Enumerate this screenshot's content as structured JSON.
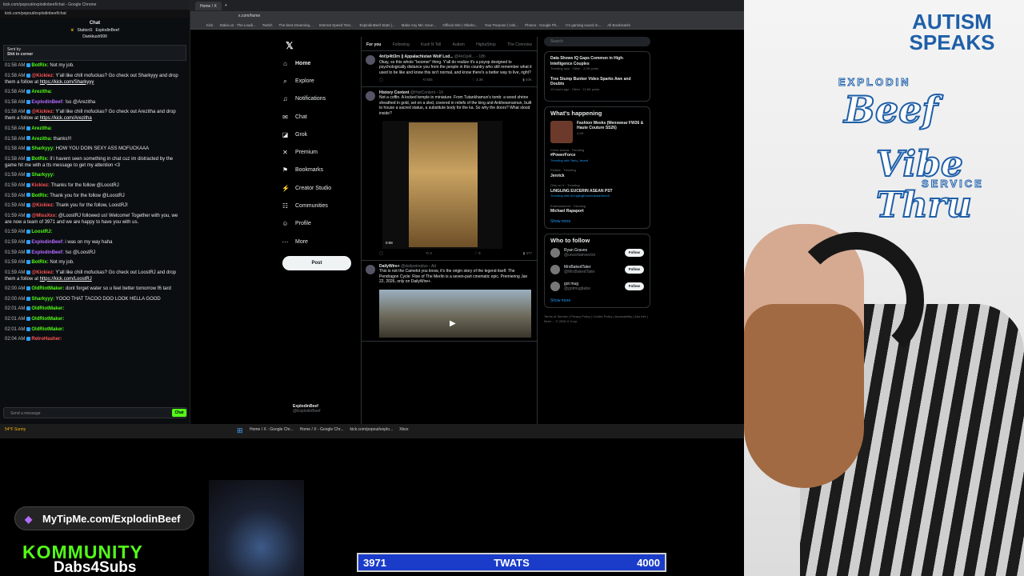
{
  "chat": {
    "window_title": "kick.com/popout/explodinbeef/chat - Google Chrome",
    "url": "kick.com/popout/explodinbeef/chat",
    "header": "Chat",
    "leaders": [
      "StationS",
      "ExplodinBeef",
      "Dankkush999"
    ],
    "pinned_by": "Sent by",
    "pinned_text": "Shit in corner",
    "messages": [
      {
        "time": "01:58 AM",
        "user": "BotRix:",
        "color": "#53fc18",
        "text": "Not my job.",
        "link": ""
      },
      {
        "time": "01:58 AM",
        "user": "@Kickiez:",
        "color": "#f55",
        "text": "Y'all like chill mofuckas? Go check out Sharkyyy and drop them a follow at",
        "link": "https://kick.com/Sharkyyy"
      },
      {
        "time": "01:58 AM",
        "user": "Arezitha:",
        "color": "#53fc18",
        "text": "",
        "link": ""
      },
      {
        "time": "01:58 AM",
        "user": "ExplodinBeef:",
        "color": "#b36bff",
        "text": "!so @Arezitha",
        "link": ""
      },
      {
        "time": "01:58 AM",
        "user": "@Kickiez:",
        "color": "#f55",
        "text": "Y'all like chill mofuckas? Go check out Arezitha and drop them a follow at",
        "link": "https://kick.com/Arezitha"
      },
      {
        "time": "01:58 AM",
        "user": "Arezitha:",
        "color": "#53fc18",
        "text": "",
        "link": ""
      },
      {
        "time": "01:58 AM",
        "user": "Arezitha:",
        "color": "#53fc18",
        "text": "thanks!!!",
        "link": ""
      },
      {
        "time": "01:58 AM",
        "user": "Sharkyyy:",
        "color": "#53fc18",
        "text": "HOW YOU DOIN SEXY ASS MOFUCKAAA",
        "link": ""
      },
      {
        "time": "01:58 AM",
        "user": "BotRix:",
        "color": "#53fc18",
        "text": "if i havent seen something in chat cuz im distracted by the game hit me with a tts message to get my attention <3",
        "link": ""
      },
      {
        "time": "01:59 AM",
        "user": "Sharkyyy:",
        "color": "#53fc18",
        "text": "",
        "link": ""
      },
      {
        "time": "01:59 AM",
        "user": "Kickiez:",
        "color": "#f55",
        "text": "Thanks for the follow @LoostRJ",
        "link": ""
      },
      {
        "time": "01:59 AM",
        "user": "BotRix:",
        "color": "#53fc18",
        "text": "Thank you for the follow @LoostRJ",
        "link": ""
      },
      {
        "time": "01:59 AM",
        "user": "@Kickiez:",
        "color": "#f55",
        "text": "Thank you for the follow, LoostRJ!",
        "link": ""
      },
      {
        "time": "01:59 AM",
        "user": "@MissXxx:",
        "color": "#f55",
        "text": "@LoostRJ followed us! Welcome! Together with you, we are now a team of 3971 and we are happy to have you with us.",
        "link": ""
      },
      {
        "time": "01:59 AM",
        "user": "LoostRJ:",
        "color": "#53fc18",
        "text": "",
        "link": ""
      },
      {
        "time": "01:59 AM",
        "user": "ExplodinBeef:",
        "color": "#b36bff",
        "text": "i was on my way haha",
        "link": ""
      },
      {
        "time": "01:59 AM",
        "user": "ExplodinBeef:",
        "color": "#b36bff",
        "text": "!so @LoostRJ",
        "link": ""
      },
      {
        "time": "01:59 AM",
        "user": "BotRix:",
        "color": "#53fc18",
        "text": "Not my job.",
        "link": ""
      },
      {
        "time": "01:59 AM",
        "user": "@Kickiez:",
        "color": "#f55",
        "text": "Y'all like chill mofuckas? Go check out LoostRJ and drop them a follow at",
        "link": "https://kick.com/LoostRJ"
      },
      {
        "time": "02:00 AM",
        "user": "OldRiotMaker:",
        "color": "#53fc18",
        "text": "dont forget water so u feel better tomorrow f6 tard",
        "link": ""
      },
      {
        "time": "02:00 AM",
        "user": "Sharkyyy:",
        "color": "#53fc18",
        "text": "YOOO THAT TACOO DOO LOOK HELLA GOOD",
        "link": ""
      },
      {
        "time": "02:01 AM",
        "user": "OldRiotMaker:",
        "color": "#53fc18",
        "text": "",
        "link": ""
      },
      {
        "time": "02:01 AM",
        "user": "OldRiotMaker:",
        "color": "#53fc18",
        "text": "",
        "link": ""
      },
      {
        "time": "02:01 AM",
        "user": "OldRiotMaker:",
        "color": "#53fc18",
        "text": "",
        "link": ""
      },
      {
        "time": "02:04 AM",
        "user": "RetroHasher:",
        "color": "#f55",
        "text": "",
        "link": ""
      }
    ],
    "input_placeholder": "Send a message",
    "send_label": "Chat"
  },
  "browser": {
    "tabs": [
      "Home / X"
    ],
    "url": "x.com/home",
    "bookmarks": [
      "Kick",
      "Stake.us - The Leadi...",
      "Twitch",
      "The best streaming...",
      "Internet Speed Test...",
      "ExplodinBeef Stats |...",
      "Make Any Mic Soun...",
      "Official Site | Oklaho...",
      "Your Purpose | Unk...",
      "Photos - Google Ph...",
      "I'm gaming sound m...",
      "All Bookmarks"
    ]
  },
  "x": {
    "nav": [
      {
        "label": "Home",
        "icon": "⌂",
        "name": "home"
      },
      {
        "label": "Explore",
        "icon": "⌕",
        "name": "search"
      },
      {
        "label": "Notifications",
        "icon": "♫",
        "name": "bell"
      },
      {
        "label": "Chat",
        "icon": "✉",
        "name": "mail"
      },
      {
        "label": "Grok",
        "icon": "◪",
        "name": "grok"
      },
      {
        "label": "Premium",
        "icon": "✕",
        "name": "x-logo"
      },
      {
        "label": "Bookmarks",
        "icon": "⚑",
        "name": "bookmark"
      },
      {
        "label": "Creator Studio",
        "icon": "⚡",
        "name": "creator"
      },
      {
        "label": "Communities",
        "icon": "☷",
        "name": "people"
      },
      {
        "label": "Profile",
        "icon": "☺",
        "name": "user"
      },
      {
        "label": "More",
        "icon": "⋯",
        "name": "more"
      }
    ],
    "post_label": "Post",
    "profile_name": "ExplodinBeef",
    "profile_handle": "@ExplodinBeef",
    "feed_tabs": [
      "For you",
      "Following",
      "Kush N Tell",
      "Autism",
      "HighaShop",
      "The Connoiss"
    ],
    "tweets": [
      {
        "name": "4nt!p4tt3rn || Appalachistan Wolf Lod...",
        "handle": "@4nt1p4t...",
        "time": "18h",
        "text": "Okay, so this whole \"boomer\" thing. Y'all do realize it's a psyop designed to psychologically distance you from the people in this country who still remember what it used to be like and know this isn't normal, and know there's a better way to live, right?",
        "stats": [
          "555",
          "3.3K",
          "40K"
        ]
      },
      {
        "name": "History Content",
        "handle": "@HistContent",
        "time": "1h",
        "text": "Not a coffin. A locked temple in miniature. From Tutankhamun's tomb: a wood shrine sheathed in gold, set on a sled, covered in reliefs of the king and Ankhesenamun, built to house a sacred statue, a substitute body for the ka. So why the doors? What stood inside?",
        "video_time": "0:08",
        "stats": [
          "3",
          "9",
          "377"
        ]
      },
      {
        "name": "DailyWire+",
        "handle": "@dailywireplus",
        "time": "Ad",
        "text": "This is not the Camelot you know, it's the origin story of the legend itself. The Pendragon Cycle: Rise of The Merlin is a seven-part cinematic epic. Premiering Jan 22, 2026, only on DailyWire+.",
        "stats": []
      }
    ],
    "search_placeholder": "Search",
    "trending_top": [
      {
        "label": "Data Shows IQ Gaps Common in High-Intelligence Couples",
        "meta": "Trending now · Other · 2.0K posts"
      },
      {
        "label": "Tree Stump Bunker Video Sparks Awe and Doubts",
        "meta": "14 hours ago · Other · 11.6K posts"
      }
    ],
    "whats_happening_title": "What's happening",
    "featured": "Fashion Weeks (Menswear FW26 & Haute Couture SS26)",
    "featured_meta": "LIVE",
    "trends": [
      {
        "cat": "Crime drama · Trending",
        "name": "#PowerForce",
        "sub": "Trending with Tariq, Jerard"
      },
      {
        "cat": "Politics · Trending",
        "name": "Jenrick",
        "sub": ""
      },
      {
        "cat": "Only on X · Trending",
        "name": "LINGLING EUCERIN ASEAN PST",
        "sub": "Trending with #LinglingEucerinAsiaSerieX"
      },
      {
        "cat": "Entertainment · Trending",
        "name": "Michael Rapaport",
        "sub": ""
      }
    ],
    "show_more": "Show more",
    "who_to_follow_title": "Who to follow",
    "follow_suggestions": [
      {
        "name": "Ryan Graves",
        "handle": "@uncertainvector"
      },
      {
        "name": "MrsBakedTater",
        "handle": "@MrsBakedTater"
      },
      {
        "name": "got mug",
        "handle": "@gotmugbabe"
      }
    ],
    "follow_label": "Follow",
    "footer": "Terms of Service | Privacy Policy | Cookie Policy | Accessibility | Ads info | More ... © 2026 X Corp."
  },
  "taskbar": {
    "weather": "54°F Sunny",
    "items": [
      "Home / X - Google Chr...",
      "Home / X - Google Chr...",
      "kick.com/popout/explo...",
      "Xbox"
    ]
  },
  "overlay": {
    "brand_top": "AUTISM SPEAKS",
    "logo_line1": "EXPLODIN",
    "logo_line2": "Beef",
    "logo_line3": "Vibe Thru",
    "logo_line4": "SERVICE",
    "tip_text": "MyTipMe.com/ExplodinBeef",
    "community_word": "KOMMUNITY",
    "community_sub": "Dabs4Subs",
    "goal_current": "3971",
    "goal_label": "TWATS",
    "goal_target": "4000",
    "goal_progress": 0.9928
  }
}
